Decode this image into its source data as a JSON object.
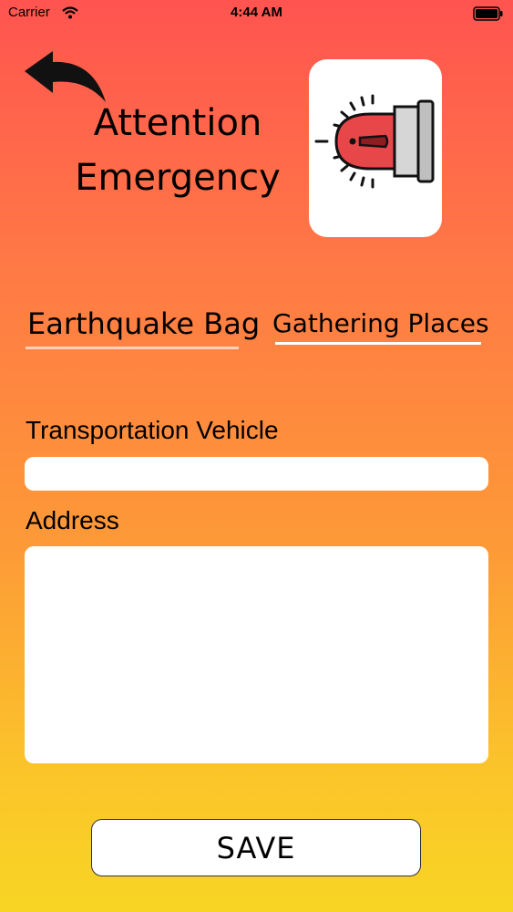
{
  "status_bar": {
    "carrier": "Carrier",
    "time": "4:44 AM"
  },
  "header": {
    "title_line1": "Attention",
    "title_line2": "Emergency",
    "back_icon": "back-arrow-icon",
    "logo_icon": "emergency-siren-icon"
  },
  "tabs": [
    {
      "label": "Earthquake Bag"
    },
    {
      "label": "Gathering Places"
    }
  ],
  "form": {
    "vehicle_label": "Transportation Vehicle",
    "vehicle_value": "",
    "address_label": "Address",
    "address_value": ""
  },
  "actions": {
    "save_label": "SAVE"
  },
  "colors": {
    "gradient_top": "#ff5450",
    "gradient_bottom": "#f8d524",
    "siren_red": "#e8474a"
  }
}
